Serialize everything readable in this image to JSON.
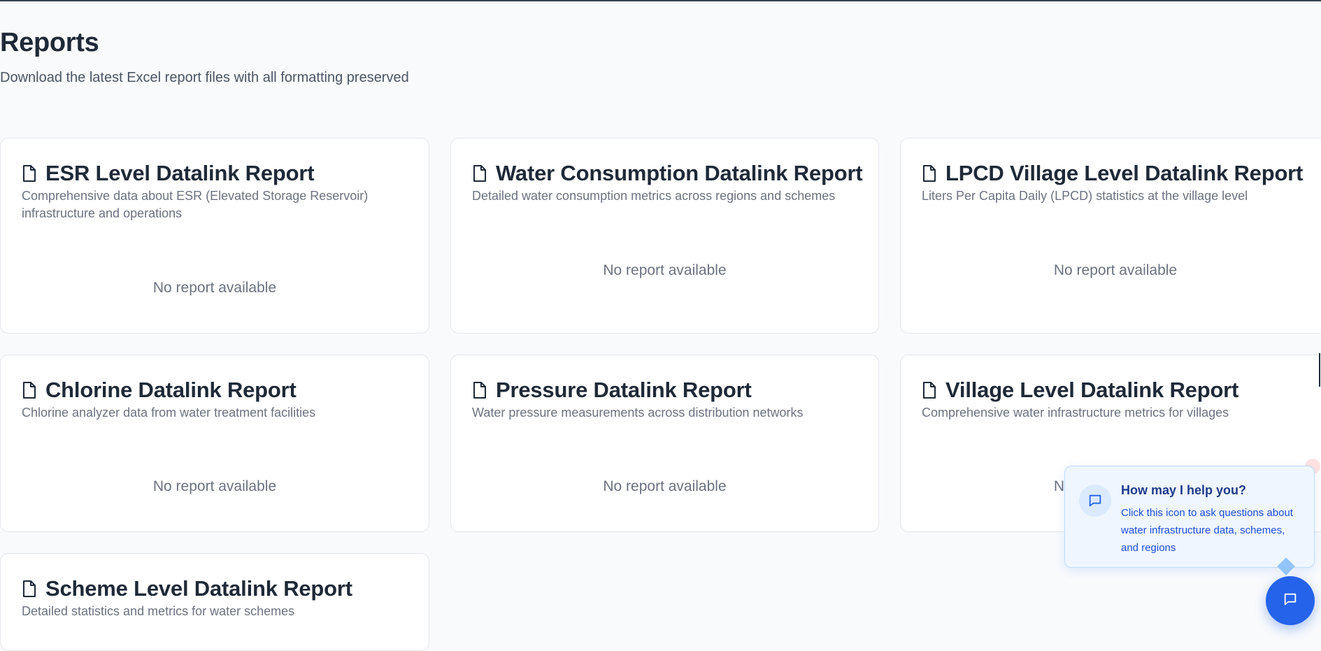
{
  "page": {
    "title": "Reports",
    "subtitle": "Download the latest Excel report files with all formatting preserved"
  },
  "reports": [
    {
      "title": "ESR Level Datalink Report",
      "description": "Comprehensive data about ESR (Elevated Storage Reservoir) infrastructure and operations",
      "status": "No report available",
      "icon": "file-icon"
    },
    {
      "title": "Water Consumption Datalink Report",
      "description": "Detailed water consumption metrics across regions and schemes",
      "status": "No report available",
      "icon": "file-icon"
    },
    {
      "title": "LPCD Village Level Datalink Report",
      "description": "Liters Per Capita Daily (LPCD) statistics at the village level",
      "status": "No report available",
      "icon": "file-icon"
    },
    {
      "title": "Chlorine Datalink Report",
      "description": "Chlorine analyzer data from water treatment facilities",
      "status": "No report available",
      "icon": "file-icon"
    },
    {
      "title": "Pressure Datalink Report",
      "description": "Water pressure measurements across distribution networks",
      "status": "No report available",
      "icon": "file-icon"
    },
    {
      "title": "Village Level Datalink Report",
      "description": "Comprehensive water infrastructure metrics for villages",
      "status": "No report available",
      "icon": "file-icon"
    },
    {
      "title": "Scheme Level Datalink Report",
      "description": "Detailed statistics and metrics for water schemes",
      "status": "",
      "icon": "file-icon"
    }
  ],
  "assistant": {
    "title": "How may I help you?",
    "text": "Click this icon to ask questions about water infrastructure data, schemes, and regions",
    "icon": "chat-icon"
  },
  "colors": {
    "accent": "#2563eb",
    "background": "#f8fafc",
    "card": "#ffffff",
    "muted_text": "#6b7280"
  }
}
